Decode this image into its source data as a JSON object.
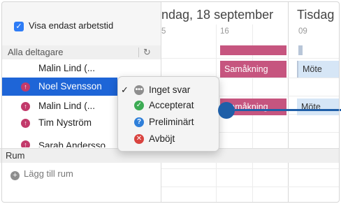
{
  "options": {
    "show_working_hours_label": "Visa endast arbetstid"
  },
  "participants": {
    "header": "Alla deltagare",
    "refresh_icon": "↻",
    "rows": [
      {
        "name": "Malin Lind (...",
        "has_status": false
      },
      {
        "name": "Noel Svensson",
        "status_icon": "arrow-up",
        "selected": true
      },
      {
        "name": "Malin Lind (...",
        "status_icon": "arrow-up"
      },
      {
        "name": "Tim Nyström",
        "status_icon": "arrow-up"
      },
      {
        "name": "Sarah Andersso...",
        "status_icon": "arrow-up"
      }
    ]
  },
  "rooms": {
    "header": "Rum",
    "add_label": "Lägg till rum"
  },
  "calendar": {
    "day1_title": "ndag, 18 september",
    "day2_title": "Tisdag",
    "hours": [
      "5",
      "16",
      "09"
    ],
    "events": [
      {
        "label": "Samåkning",
        "color": "#c6557f"
      },
      {
        "label": "Möte",
        "color": "#d6e6f6"
      },
      {
        "label": "Samåkning",
        "color": "#c6557f"
      },
      {
        "label": "Möte",
        "color": "#d6e6f6"
      }
    ]
  },
  "status_menu": {
    "check_mark": "✓",
    "items": [
      {
        "label": "Inget svar",
        "icon": "dots-icon",
        "color": "#8e8e8e",
        "checked": true
      },
      {
        "label": "Accepterat",
        "icon": "check-icon",
        "color": "#3cab54"
      },
      {
        "label": "Preliminärt",
        "icon": "question-icon",
        "color": "#2f7fd9"
      },
      {
        "label": "Avböjt",
        "icon": "x-icon",
        "color": "#d9433f"
      }
    ]
  },
  "colors": {
    "accent": "#1e65d7",
    "pointer": "#1f5fa8"
  }
}
